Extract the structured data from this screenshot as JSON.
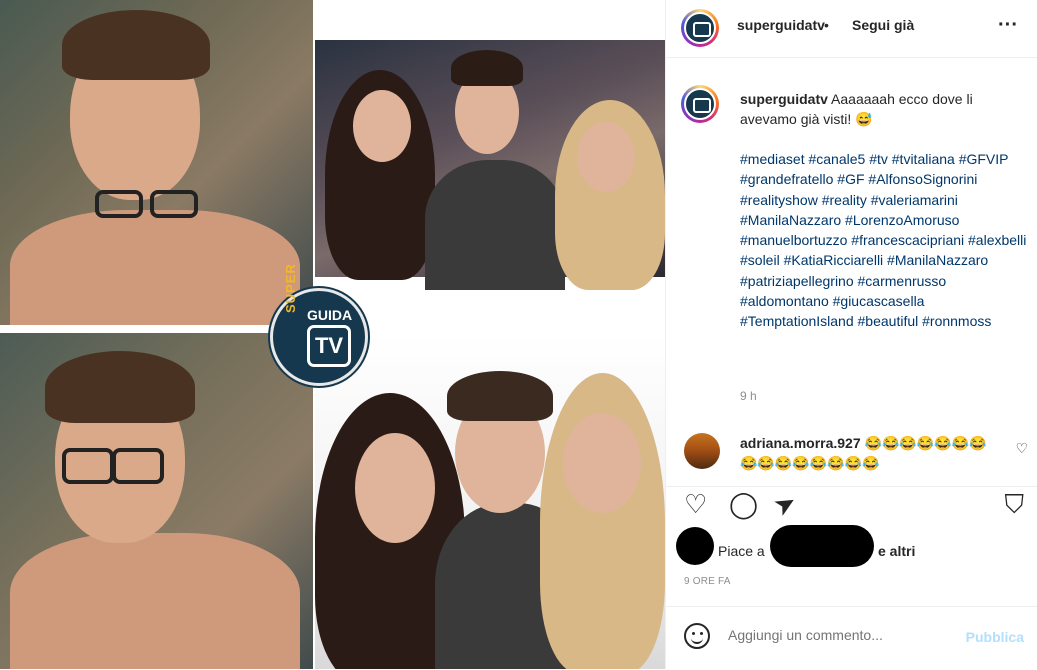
{
  "post": {
    "username": "superguidatv",
    "separator": "•",
    "follow_label": "Segui già",
    "more_label": "···"
  },
  "media": {
    "logo_super": "SUPER",
    "logo_guida": "GUIDA",
    "logo_tv": "TV"
  },
  "caption": {
    "username": "superguidatv",
    "text": "Aaaaaaah ecco dove li avevamo già visti! 😅",
    "hashtags": "#mediaset #canale5 #tv #tvitaliana #GFVIP #grandefratello #GF #AlfonsoSignorini #realityshow #reality #valeriamarini #ManilaNazzaro #LorenzoAmoruso #manuelbortuzzo #francescacipriani #alexbelli #soleil #KatiaRicciarelli #ManilaNazzaro #patriziapellegrino #carmenrusso #aldomontano #giucascasella #TemptationIsland #beautiful #ronnmoss",
    "time": "9 h"
  },
  "comment": {
    "username": "adriana.morra.927",
    "text": "😂😂😂😂😂😂😂😂😂😂😂😂😂😂😂",
    "like_icon": "♡"
  },
  "actions": {
    "like_icon": "♡",
    "comment_icon": "◯",
    "share_icon": "➤",
    "save_icon": "⛉"
  },
  "likes": {
    "prefix": "Piace a",
    "suffix": "e altri"
  },
  "timestamp": "9 ORE FA",
  "add_comment": {
    "placeholder": "Aggiungi un commento...",
    "publish_label": "Pubblica"
  },
  "colors": {
    "link": "#00376b",
    "muted": "#8e8e8e",
    "publish_disabled": "#b2dffc",
    "logo_navy": "#16384f",
    "logo_yellow": "#f2b72a"
  }
}
